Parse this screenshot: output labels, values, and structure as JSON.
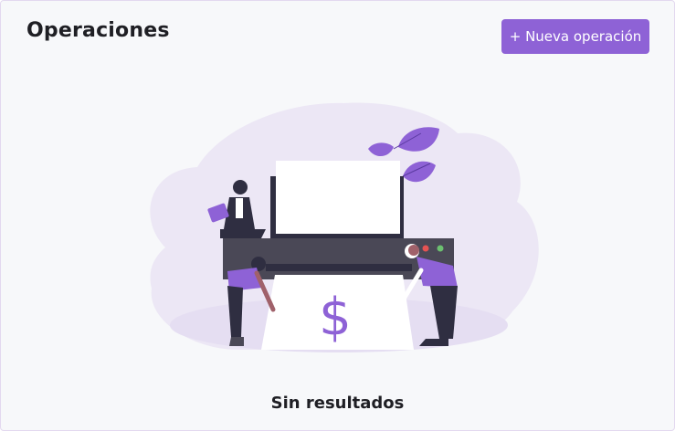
{
  "header": {
    "title": "Operaciones",
    "new_button_label": "+ Nueva operación"
  },
  "empty_state": {
    "message": "Sin resultados",
    "illustration_symbol": "$"
  },
  "colors": {
    "accent": "#8e62d6",
    "blob": "#ece7f5",
    "printer": "#3f3d4a",
    "printer_dark": "#2f2e41",
    "paper": "#ffffff"
  }
}
